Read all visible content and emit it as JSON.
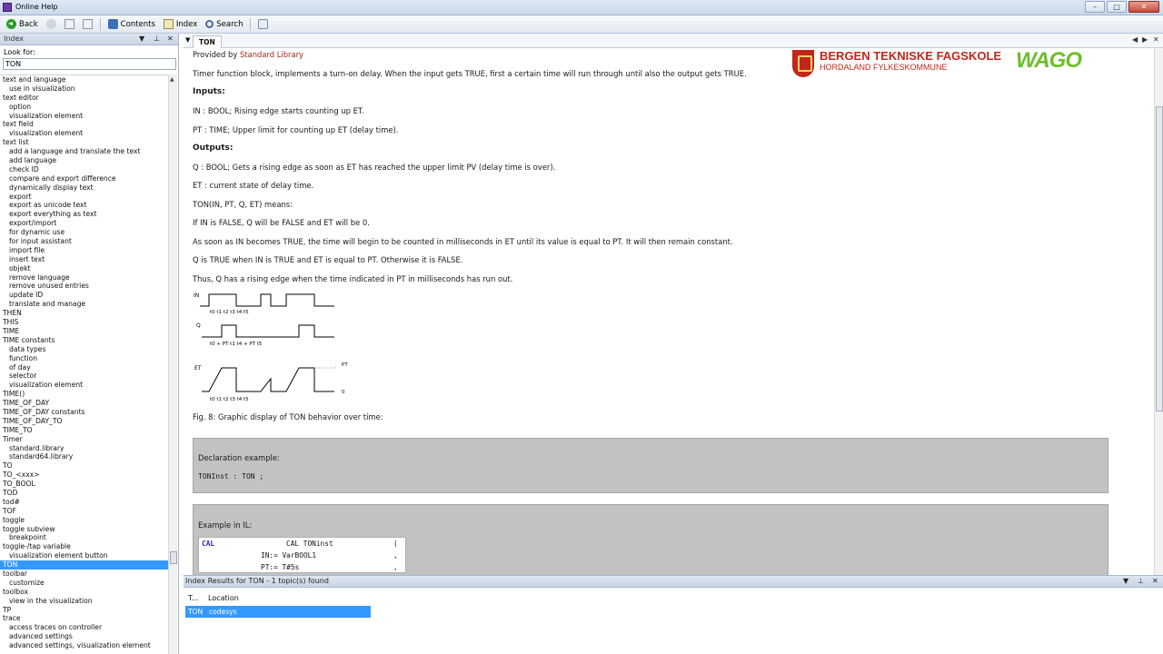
{
  "window": {
    "title": "Online Help",
    "buttons": [
      "–",
      "□",
      "✕"
    ]
  },
  "toolbar": {
    "back": "Back",
    "contents": "Contents",
    "index": "Index",
    "search": "Search"
  },
  "left_pane": {
    "header": "Index",
    "look_for_label": "Look for:",
    "look_for_value": "TON",
    "items": [
      {
        "text": "text and language",
        "indent": false
      },
      {
        "text": "use in visualization",
        "indent": true
      },
      {
        "text": "text editor",
        "indent": false
      },
      {
        "text": "option",
        "indent": true
      },
      {
        "text": "visualization element",
        "indent": true
      },
      {
        "text": "text field",
        "indent": false
      },
      {
        "text": "visualization element",
        "indent": true
      },
      {
        "text": "text list",
        "indent": false
      },
      {
        "text": "add a language and translate the text",
        "indent": true
      },
      {
        "text": "add language",
        "indent": true
      },
      {
        "text": "check ID",
        "indent": true
      },
      {
        "text": "compare and export difference",
        "indent": true
      },
      {
        "text": "dynamically display text",
        "indent": true
      },
      {
        "text": "export",
        "indent": true
      },
      {
        "text": "export as unicode text",
        "indent": true
      },
      {
        "text": "export everything as text",
        "indent": true
      },
      {
        "text": "export/import",
        "indent": true
      },
      {
        "text": "for dynamic use",
        "indent": true
      },
      {
        "text": "for input assistant",
        "indent": true
      },
      {
        "text": "import file",
        "indent": true
      },
      {
        "text": "insert text",
        "indent": true
      },
      {
        "text": "objekt",
        "indent": true
      },
      {
        "text": "remove language",
        "indent": true
      },
      {
        "text": "remove unused entries",
        "indent": true
      },
      {
        "text": "update ID",
        "indent": true
      },
      {
        "text": "translate and manage",
        "indent": true
      },
      {
        "text": "THEN",
        "indent": false
      },
      {
        "text": "THIS",
        "indent": false
      },
      {
        "text": "TIME",
        "indent": false
      },
      {
        "text": "TIME constants",
        "indent": false
      },
      {
        "text": "data types",
        "indent": true
      },
      {
        "text": "function",
        "indent": true
      },
      {
        "text": "of day",
        "indent": true
      },
      {
        "text": "selector",
        "indent": true
      },
      {
        "text": "visualization element",
        "indent": true
      },
      {
        "text": "TIME()",
        "indent": false
      },
      {
        "text": "TIME_OF_DAY",
        "indent": false
      },
      {
        "text": "TIME_OF_DAY constants",
        "indent": false
      },
      {
        "text": "TIME_OF_DAY_TO",
        "indent": false
      },
      {
        "text": "TIME_TO",
        "indent": false
      },
      {
        "text": "Timer",
        "indent": false
      },
      {
        "text": "standard.library",
        "indent": true
      },
      {
        "text": "standard64.library",
        "indent": true
      },
      {
        "text": "TO",
        "indent": false
      },
      {
        "text": "TO_<xxx>",
        "indent": false
      },
      {
        "text": "TO_BOOL",
        "indent": false
      },
      {
        "text": "TOD",
        "indent": false
      },
      {
        "text": "tod#",
        "indent": false
      },
      {
        "text": "TOF",
        "indent": false
      },
      {
        "text": "toggle",
        "indent": false
      },
      {
        "text": "toggle subview",
        "indent": false
      },
      {
        "text": "breakpoint",
        "indent": true
      },
      {
        "text": "toggle-/tap variable",
        "indent": false
      },
      {
        "text": "visualization element button",
        "indent": true
      },
      {
        "text": "TON",
        "indent": false,
        "selected": true
      },
      {
        "text": "toolbar",
        "indent": false
      },
      {
        "text": "customize",
        "indent": true
      },
      {
        "text": "toolbox",
        "indent": false
      },
      {
        "text": "view in the visualization",
        "indent": true
      },
      {
        "text": "TP",
        "indent": false
      },
      {
        "text": "trace",
        "indent": false
      },
      {
        "text": "access traces on controller",
        "indent": true
      },
      {
        "text": "advanced settings",
        "indent": true
      },
      {
        "text": "advanced settings, visualization element",
        "indent": true
      }
    ]
  },
  "doc": {
    "tab": "TON",
    "provided_prefix": "Provided by",
    "provided_link": "Standard Library",
    "intro": "Timer function block, implements a turn-on delay. When the input gets TRUE, first a certain time will run through until also the output gets TRUE.",
    "inputs_heading": "Inputs:",
    "in_line": "IN : BOOL; Rising edge starts counting up ET.",
    "pt_line": "PT : TIME; Upper limit for counting up ET (delay time).",
    "outputs_heading": "Outputs:",
    "q_line": "Q : BOOL; Gets a rising edge as soon as ET has reached the upper limit PV (delay time is over).",
    "et_line": "ET : current state of delay time.",
    "means_line": "TON(IN, PT, Q, ET) means:",
    "false_line": "If IN is FALSE, Q will be FALSE and ET will be 0.",
    "true_line": "As soon as IN becomes TRUE, the time will begin to be counted in milliseconds in ET until its value is equal to PT. It will then remain constant.",
    "q_true_line": "Q is TRUE when IN is TRUE and ET is equal to PT. Otherwise it is FALSE.",
    "thus_line": "Thus, Q has a rising edge when the time indicated in PT in milliseconds has run out.",
    "fig_caption": "Fig. 8: Graphic display of TON behavior over time:",
    "decl_label": "Declaration example:",
    "decl_code": "TONInst : TON ;",
    "il_label": "Example in IL:",
    "il_code": [
      "CAL        TONinst",
      "IN:= VarBOOL1",
      "PT:= T#5s"
    ],
    "il_keyword": "CAL",
    "il_paren": "(",
    "il_commas": [
      ",",
      ","
    ],
    "logo_school_line1": "BERGEN TEKNISKE FAGSKOLE",
    "logo_school_line2": "HORDALAND FYLKESKOMMUNE",
    "logo_brand": "WAGO",
    "diagram": {
      "in_label": "IN",
      "q_label": "Q",
      "et_label": "ET",
      "pt_label": "PT",
      "zero_label": "0",
      "in_ticks": "t0        t1       t2 t3     t4          t5",
      "q_ticks": "t0 + PT  t1                 t4 + PT  t5",
      "et_ticks": "t0        t1       t2 t3     t4          t5"
    }
  },
  "bottom": {
    "header": "Index Results for TON - 1 topic(s) found",
    "col_title": "T...",
    "col_location": "Location",
    "result_title": "TON",
    "result_location": "codesys"
  }
}
